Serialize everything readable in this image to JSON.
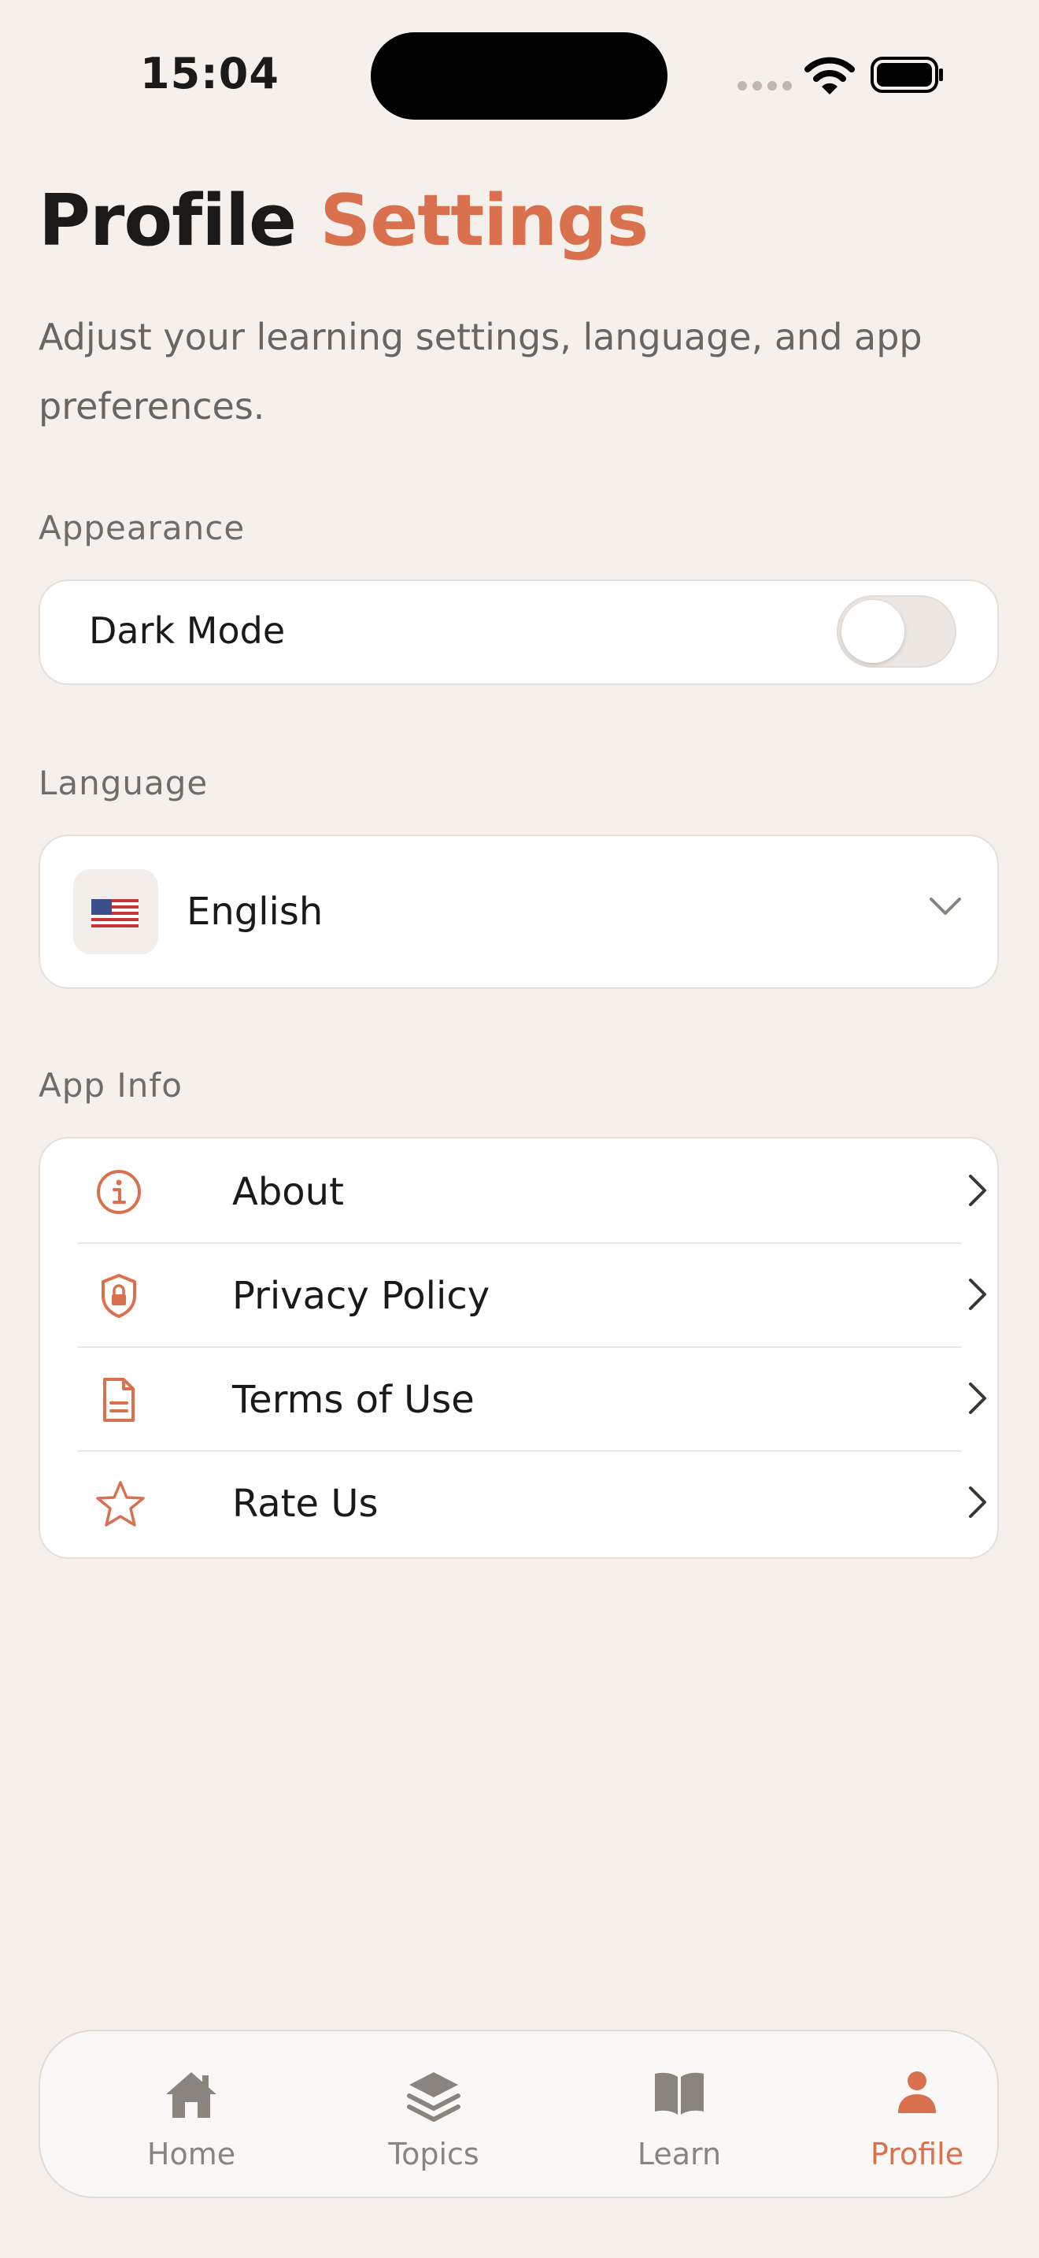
{
  "status_bar": {
    "time": "15:04"
  },
  "header": {
    "title_main": "Profile",
    "title_accent": "Settings",
    "subtitle": "Adjust your learning settings, language, and app preferences."
  },
  "appearance": {
    "section_label": "Appearance",
    "dark_mode_label": "Dark Mode",
    "dark_mode_on": false
  },
  "language": {
    "section_label": "Language",
    "selected": "English",
    "flag_icon": "us-flag-icon"
  },
  "app_info": {
    "section_label": "App Info",
    "items": [
      {
        "label": "About",
        "icon": "info-icon"
      },
      {
        "label": "Privacy Policy",
        "icon": "shield-lock-icon"
      },
      {
        "label": "Terms of Use",
        "icon": "document-icon"
      },
      {
        "label": "Rate Us",
        "icon": "star-icon"
      }
    ]
  },
  "tab_bar": {
    "tabs": [
      {
        "label": "Home",
        "icon": "home-icon",
        "active": false
      },
      {
        "label": "Topics",
        "icon": "layers-icon",
        "active": false
      },
      {
        "label": "Learn",
        "icon": "book-icon",
        "active": false
      },
      {
        "label": "Profile",
        "icon": "person-icon",
        "active": true
      }
    ]
  },
  "colors": {
    "accent": "#d9714f",
    "background": "#f5f0ec",
    "card": "#ffffff",
    "muted_text": "#6b6560",
    "inactive_tab": "#8a847f"
  }
}
